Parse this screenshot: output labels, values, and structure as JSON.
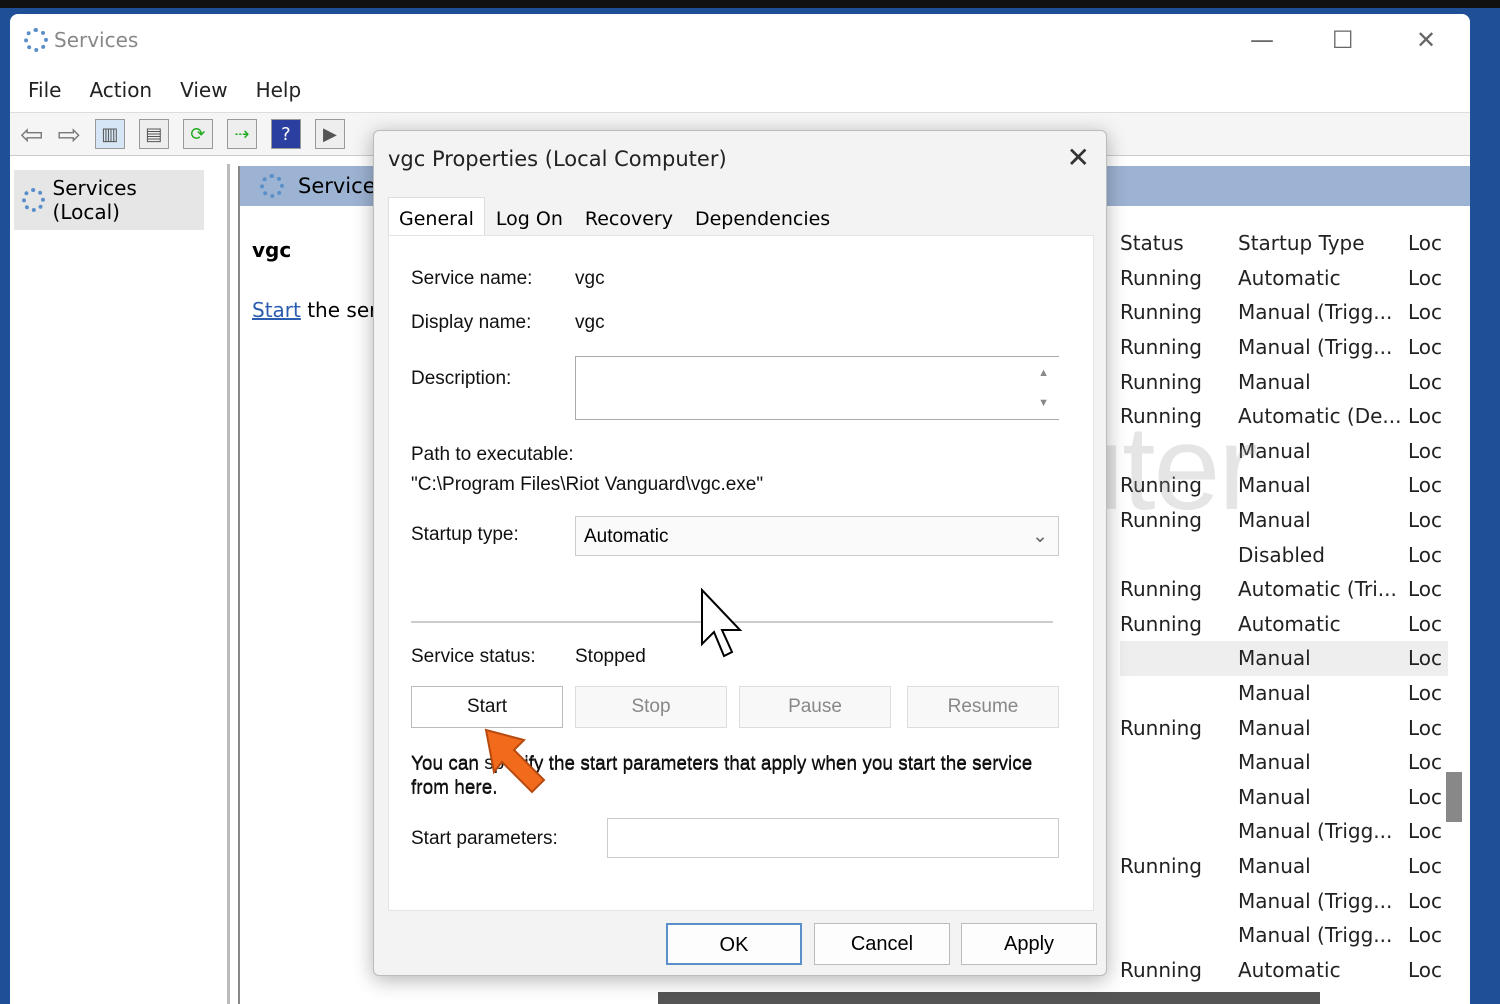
{
  "window": {
    "title": "Services",
    "menu": [
      "File",
      "Action",
      "View",
      "Help"
    ]
  },
  "tree": {
    "item": "Services (Local)"
  },
  "pane": {
    "header": "Services",
    "selected_name": "vgc",
    "start_link": "Start",
    "start_text": " the serv"
  },
  "list": {
    "headers": [
      "Status",
      "Startup Type",
      "Loc"
    ],
    "rows": [
      [
        "Running",
        "Automatic",
        "Loc"
      ],
      [
        "Running",
        "Manual (Trigg...",
        "Loc"
      ],
      [
        "Running",
        "Manual (Trigg...",
        "Loc"
      ],
      [
        "Running",
        "Manual",
        "Loc"
      ],
      [
        "Running",
        "Automatic (De...",
        "Loc"
      ],
      [
        "",
        "Manual",
        "Loc"
      ],
      [
        "Running",
        "Manual",
        "Loc"
      ],
      [
        "Running",
        "Manual",
        "Loc"
      ],
      [
        "",
        "Disabled",
        "Loc"
      ],
      [
        "Running",
        "Automatic (Tri...",
        "Loc"
      ],
      [
        "Running",
        "Automatic",
        "Loc"
      ],
      [
        "",
        "Manual",
        "Loc"
      ],
      [
        "",
        "Manual",
        "Loc"
      ],
      [
        "Running",
        "Manual",
        "Loc"
      ],
      [
        "",
        "Manual",
        "Loc"
      ],
      [
        "",
        "Manual",
        "Loc"
      ],
      [
        "",
        "Manual (Trigg...",
        "Loc"
      ],
      [
        "Running",
        "Manual",
        "Loc"
      ],
      [
        "",
        "Manual (Trigg...",
        "Loc"
      ],
      [
        "",
        "Manual (Trigg...",
        "Loc"
      ],
      [
        "Running",
        "Automatic",
        "Loc"
      ]
    ]
  },
  "watermark": "exputer",
  "dialog": {
    "title": "vgc Properties (Local Computer)",
    "tabs": [
      "General",
      "Log On",
      "Recovery",
      "Dependencies"
    ],
    "service_name_label": "Service name:",
    "service_name": "vgc",
    "display_name_label": "Display name:",
    "display_name": "vgc",
    "description_label": "Description:",
    "description": "",
    "path_label": "Path to executable:",
    "path": "\"C:\\Program Files\\Riot Vanguard\\vgc.exe\"",
    "startup_label": "Startup type:",
    "startup_value": "Automatic",
    "status_label": "Service status:",
    "status_value": "Stopped",
    "buttons": {
      "start": "Start",
      "stop": "Stop",
      "pause": "Pause",
      "resume": "Resume"
    },
    "hint": "You can specify the start parameters that apply when you start the service from here.",
    "hint_visible_1": "You can",
    "hint_visible_2": "ify the start parameters that apply when you start the service",
    "hint_visible_3": "from here.",
    "params_label": "Start parameters:",
    "params_value": "",
    "ok": "OK",
    "cancel": "Cancel",
    "apply": "Apply"
  }
}
